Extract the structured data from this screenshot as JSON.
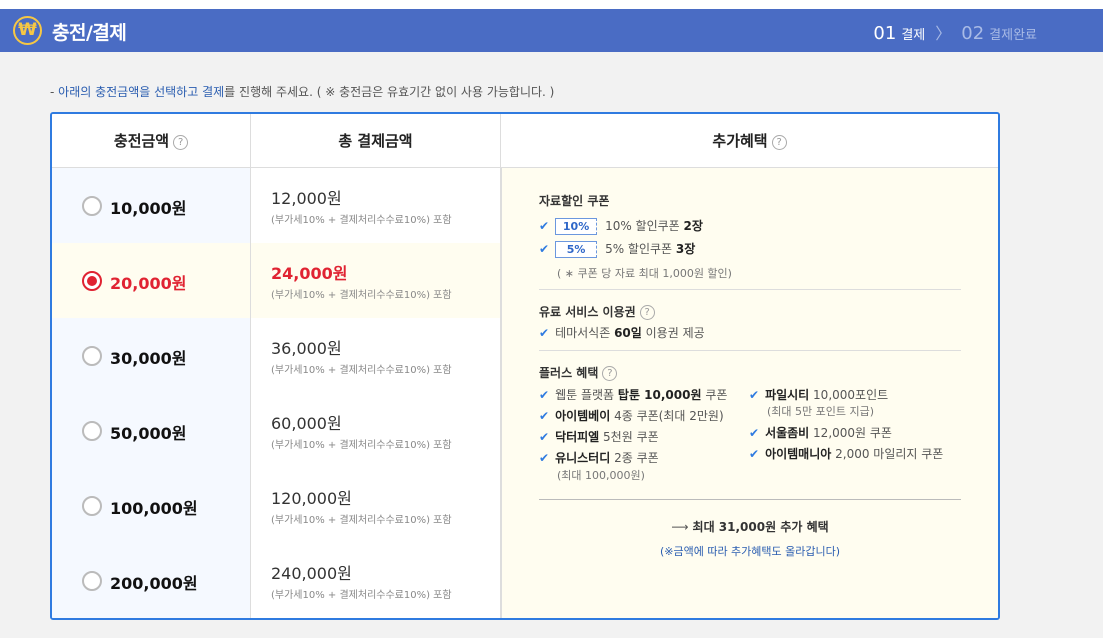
{
  "header": {
    "logo_glyph": "₩",
    "title": "충전/결제",
    "steps": [
      {
        "num": "01",
        "label": "결제",
        "active": true
      },
      {
        "num": "02",
        "label": "결제완료",
        "active": false
      }
    ],
    "step_separator": "〉"
  },
  "notice": {
    "prefix": "- ",
    "highlight1": "아래의 충전금액을 선택하고 결제",
    "middle": "를 진행해 주세요.",
    "suffix": " ( ※ 충전금은 유효기간 없이 사용 가능합니다. )"
  },
  "table": {
    "headers": {
      "amount": "충전금액",
      "total": "총 결제금액",
      "benefit": "추가혜택"
    },
    "help_glyph": "?",
    "rows": [
      {
        "amount": "10,000원",
        "total": "12,000원",
        "note": "(부가세10% + 결제처리수수료10%) 포함",
        "selected": false
      },
      {
        "amount": "20,000원",
        "total": "24,000원",
        "note": "(부가세10% + 결제처리수수료10%) 포함",
        "selected": true
      },
      {
        "amount": "30,000원",
        "total": "36,000원",
        "note": "(부가세10% + 결제처리수수료10%) 포함",
        "selected": false
      },
      {
        "amount": "50,000원",
        "total": "60,000원",
        "note": "(부가세10% + 결제처리수수료10%) 포함",
        "selected": false
      },
      {
        "amount": "100,000원",
        "total": "120,000원",
        "note": "(부가세10% + 결제처리수수료10%) 포함",
        "selected": false
      },
      {
        "amount": "200,000원",
        "total": "240,000원",
        "note": "(부가세10% + 결제처리수수료10%) 포함",
        "selected": false
      }
    ]
  },
  "benefits": {
    "check_glyph": "✔",
    "coupon": {
      "title": "자료할인 쿠폰",
      "items": [
        {
          "tag": "10%",
          "text": "10% 할인쿠폰 ",
          "count": "2장"
        },
        {
          "tag": "5%",
          "text": "5% 할인쿠폰 ",
          "count": "3장"
        }
      ],
      "note": "( ∗ 쿠폰 당 자료 최대 1,000원 할인)"
    },
    "paid": {
      "title": "유료 서비스 이용권",
      "text_before": "테마서식존 ",
      "bold": "60일",
      "text_after": " 이용권 제공"
    },
    "plus": {
      "title": "플러스 혜택",
      "left": [
        {
          "text_before": "웹툰 플랫폼 ",
          "bold": "탑툰 10,000원",
          "text_after": " 쿠폰",
          "sub": ""
        },
        {
          "text_before": "",
          "bold": "아이템베이",
          "text_after": " 4종 쿠폰(최대 2만원)",
          "sub": ""
        },
        {
          "text_before": "",
          "bold": "닥터피엘",
          "text_after": " 5천원 쿠폰",
          "sub": ""
        },
        {
          "text_before": "",
          "bold": "유니스터디",
          "text_after": " 2종 쿠폰",
          "sub": "(최대 100,000원)"
        }
      ],
      "right": [
        {
          "text_before": "",
          "bold": "파일시티",
          "text_after": " 10,000포인트",
          "sub": "(최대 5만 포인트 지급)"
        },
        {
          "text_before": "",
          "bold": "서울좀비",
          "text_after": " 12,000원 쿠폰",
          "sub": ""
        },
        {
          "text_before": "",
          "bold": "아이템매니아",
          "text_after": " 2,000 마일리지 쿠폰",
          "sub": ""
        }
      ]
    },
    "max": {
      "arrow": "⟶",
      "text": "최대 31,000원 추가 혜택",
      "note": "(※금액에 따라 추가혜택도 올라갑니다)"
    }
  },
  "colors": {
    "header_bg": "#4a6cc4",
    "accent": "#2f7be0",
    "selected_red": "#e02332",
    "benefit_bg": "#fffdf0"
  }
}
